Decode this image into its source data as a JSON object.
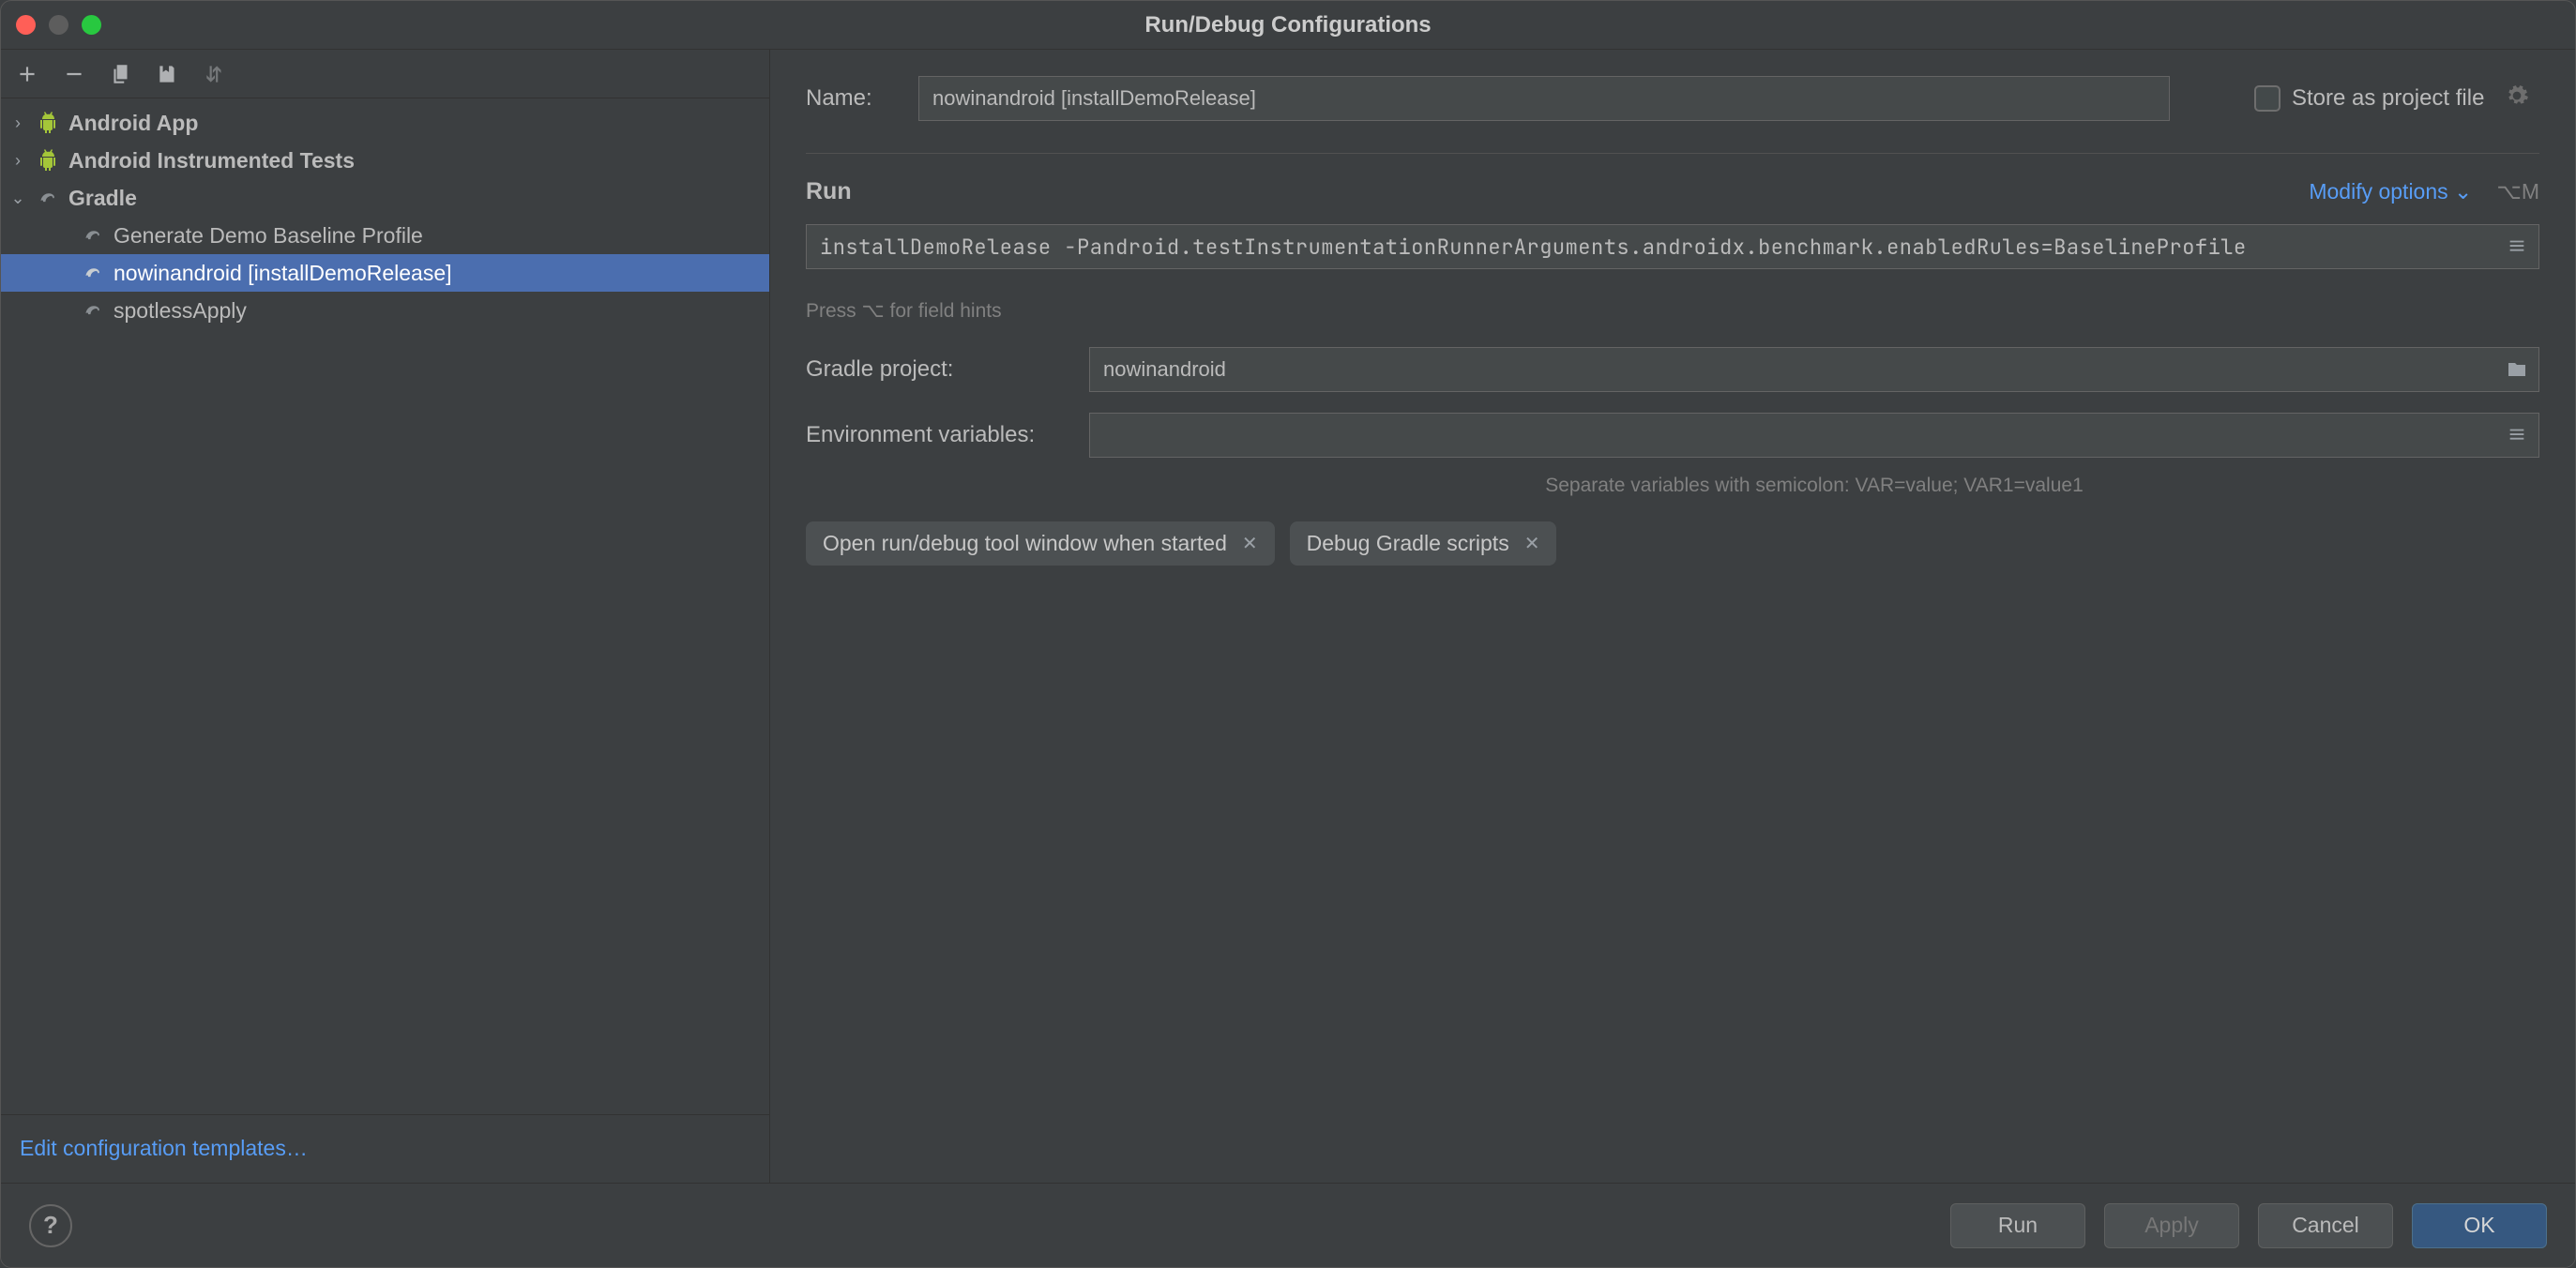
{
  "title": "Run/Debug Configurations",
  "toolbar": {
    "add": "+",
    "remove": "−"
  },
  "tree": {
    "android_app": "Android App",
    "android_instrumented": "Android Instrumented Tests",
    "gradle": "Gradle",
    "gradle_children": {
      "generate_demo": "Generate Demo Baseline Profile",
      "install_demo": "nowinandroid [installDemoRelease]",
      "spotless": "spotlessApply"
    }
  },
  "sidebar_footer_link": "Edit configuration templates…",
  "form": {
    "name_label": "Name:",
    "name_value": "nowinandroid [installDemoRelease]",
    "store_label": "Store as project file",
    "section_run": "Run",
    "modify_options": "Modify options",
    "modify_shortcut": "⌥M",
    "run_args": "installDemoRelease -Pandroid.testInstrumentationRunnerArguments.androidx.benchmark.enabledRules=BaselineProfile",
    "hint_args": "Press ⌥ for field hints",
    "gradle_project_label": "Gradle project:",
    "gradle_project_value": "nowinandroid",
    "env_label": "Environment variables:",
    "env_value": "",
    "env_hint": "Separate variables with semicolon: VAR=value; VAR1=value1",
    "chip1": "Open run/debug tool window when started",
    "chip2": "Debug Gradle scripts"
  },
  "buttons": {
    "run": "Run",
    "apply": "Apply",
    "cancel": "Cancel",
    "ok": "OK"
  }
}
